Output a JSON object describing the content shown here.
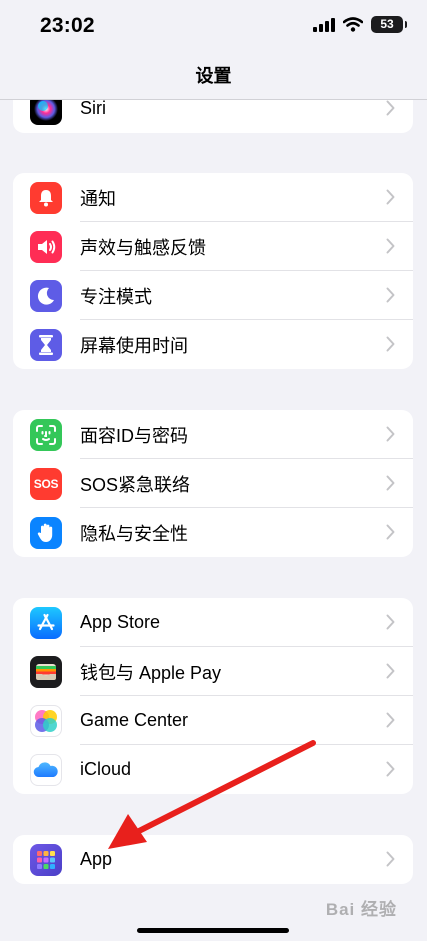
{
  "status": {
    "time": "23:02",
    "battery": "53"
  },
  "nav": {
    "title": "设置"
  },
  "groups": [
    {
      "items": [
        {
          "label": "Siri",
          "icon": "siri-icon"
        }
      ]
    },
    {
      "items": [
        {
          "label": "通知",
          "icon": "bell-icon",
          "color": "#ff3b30"
        },
        {
          "label": "声效与触感反馈",
          "icon": "speaker-icon",
          "color": "#ff2d55"
        },
        {
          "label": "专注模式",
          "icon": "moon-icon",
          "color": "#5e5ce6"
        },
        {
          "label": "屏幕使用时间",
          "icon": "hourglass-icon",
          "color": "#5e5ce6"
        }
      ]
    },
    {
      "items": [
        {
          "label": "面容ID与密码",
          "icon": "face-id-icon",
          "color": "#34c759"
        },
        {
          "label": "SOS紧急联络",
          "icon": "sos-icon",
          "color": "#ff3b30",
          "icon_text": "SOS"
        },
        {
          "label": "隐私与安全性",
          "icon": "hand-icon",
          "color": "#0a84ff"
        }
      ]
    },
    {
      "items": [
        {
          "label": "App Store",
          "icon": "app-store-icon",
          "color": "#0a84ff"
        },
        {
          "label": "钱包与 Apple Pay",
          "icon": "wallet-icon",
          "color": "#1c1c1e"
        },
        {
          "label": "Game Center",
          "icon": "game-center-icon"
        },
        {
          "label": "iCloud",
          "icon": "icloud-icon"
        }
      ]
    },
    {
      "items": [
        {
          "label": "App",
          "icon": "apps-icon",
          "color": "#5856d6"
        }
      ]
    }
  ],
  "watermark": "Bai 经验",
  "annotation": {
    "type": "red-arrow",
    "points_to": "App"
  }
}
